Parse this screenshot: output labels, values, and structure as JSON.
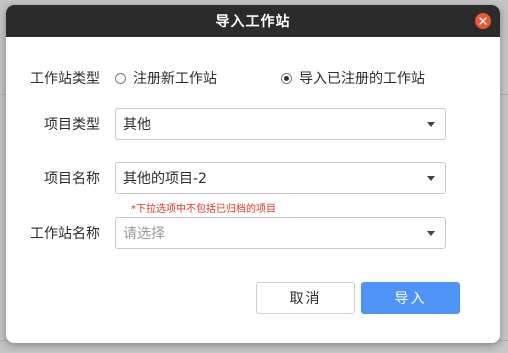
{
  "dialog": {
    "title": "导入工作站",
    "close_icon": "close-icon"
  },
  "form": {
    "workstation_type": {
      "label": "工作站类型",
      "options": [
        {
          "label": "注册新工作站",
          "checked": false
        },
        {
          "label": "导入已注册的工作站",
          "checked": true
        }
      ]
    },
    "project_type": {
      "label": "项目类型",
      "value": "其他"
    },
    "project_name": {
      "label": "项目名称",
      "value": "其他的项目-2",
      "hint": "*下拉选项中不包括已归档的项目"
    },
    "workstation_name": {
      "label": "工作站名称",
      "placeholder": "请选择"
    }
  },
  "buttons": {
    "cancel": "取消",
    "ok": "导入"
  },
  "colors": {
    "titlebar": "#2b2b2b",
    "close": "#e9582f",
    "primary": "#4d94f6",
    "hint": "#e0322a"
  }
}
